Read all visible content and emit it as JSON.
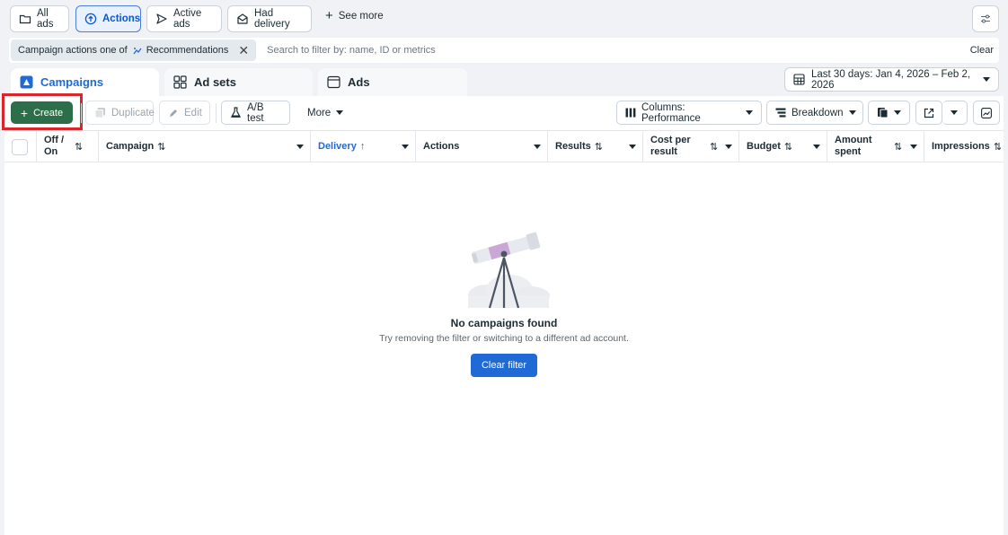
{
  "top_chips": {
    "all_ads": "All ads",
    "actions": "Actions",
    "active_ads": "Active ads",
    "had_delivery": "Had delivery",
    "see_more": "See more"
  },
  "filter": {
    "pill_prefix": "Campaign actions one of",
    "pill_value": "Recommendations",
    "search_placeholder": "Search to filter by: name, ID or metrics",
    "clear": "Clear"
  },
  "tabs": {
    "campaigns": "Campaigns",
    "ad_sets": "Ad sets",
    "ads": "Ads"
  },
  "date_range": "Last 30 days: Jan 4, 2026 – Feb 2, 2026",
  "toolbar": {
    "create": "Create",
    "duplicate": "Duplicate",
    "edit": "Edit",
    "ab_test": "A/B test",
    "more": "More",
    "columns": "Columns: Performance",
    "breakdown": "Breakdown"
  },
  "columns": {
    "off_on": "Off / On",
    "campaign": "Campaign",
    "delivery": "Delivery",
    "actions": "Actions",
    "results": "Results",
    "cost_per_result": "Cost per result",
    "budget": "Budget",
    "amount_spent": "Amount spent",
    "impressions": "Impressions"
  },
  "empty_state": {
    "title": "No campaigns found",
    "subtitle": "Try removing the filter or switching to a different ad account.",
    "button": "Clear filter"
  },
  "colors": {
    "accent_blue": "#1f6ad4",
    "create_green": "#2c6e49",
    "highlight_red": "#d9252c"
  }
}
